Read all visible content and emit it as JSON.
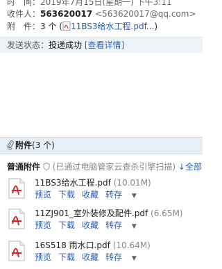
{
  "header": {
    "time_label": "时　间：",
    "time_value": "2019年7月15日(星期一) 下午3:11",
    "to_label": "收件人：",
    "to_name": "563620017",
    "to_email": "<563620017@qq.com>",
    "att_label": "附　件：",
    "att_count": "3 个",
    "att_open": "(",
    "att_first": "11BS3给水工程.pdf...",
    "att_close": ")"
  },
  "status": {
    "label": "发送状态：",
    "value": "投递成功",
    "link": "[查看详情]"
  },
  "attachments": {
    "header_label": "附件",
    "header_count": "(3 个)",
    "normal_label": "普通附件",
    "scan_note": "(已通过电脑管家云查杀引擎扫描)",
    "download_all": "全部",
    "items": [
      {
        "name": "11BS3给水工程.pdf",
        "size": "(10.01M)"
      },
      {
        "name": "11ZJ901_室外装修及配件.pdf",
        "size": "(6.65M)"
      },
      {
        "name": "16S518 雨水口.pdf",
        "size": "(10.64M)"
      }
    ],
    "actions": {
      "preview": "预览",
      "download": "下载",
      "favorite": "收藏",
      "save_to": "转存"
    }
  },
  "colors": {
    "link": "#2a5db0",
    "status_bg": "#eef3f8",
    "att_header_bg": "#e6eef6",
    "pdf_red": "#d8262a"
  }
}
